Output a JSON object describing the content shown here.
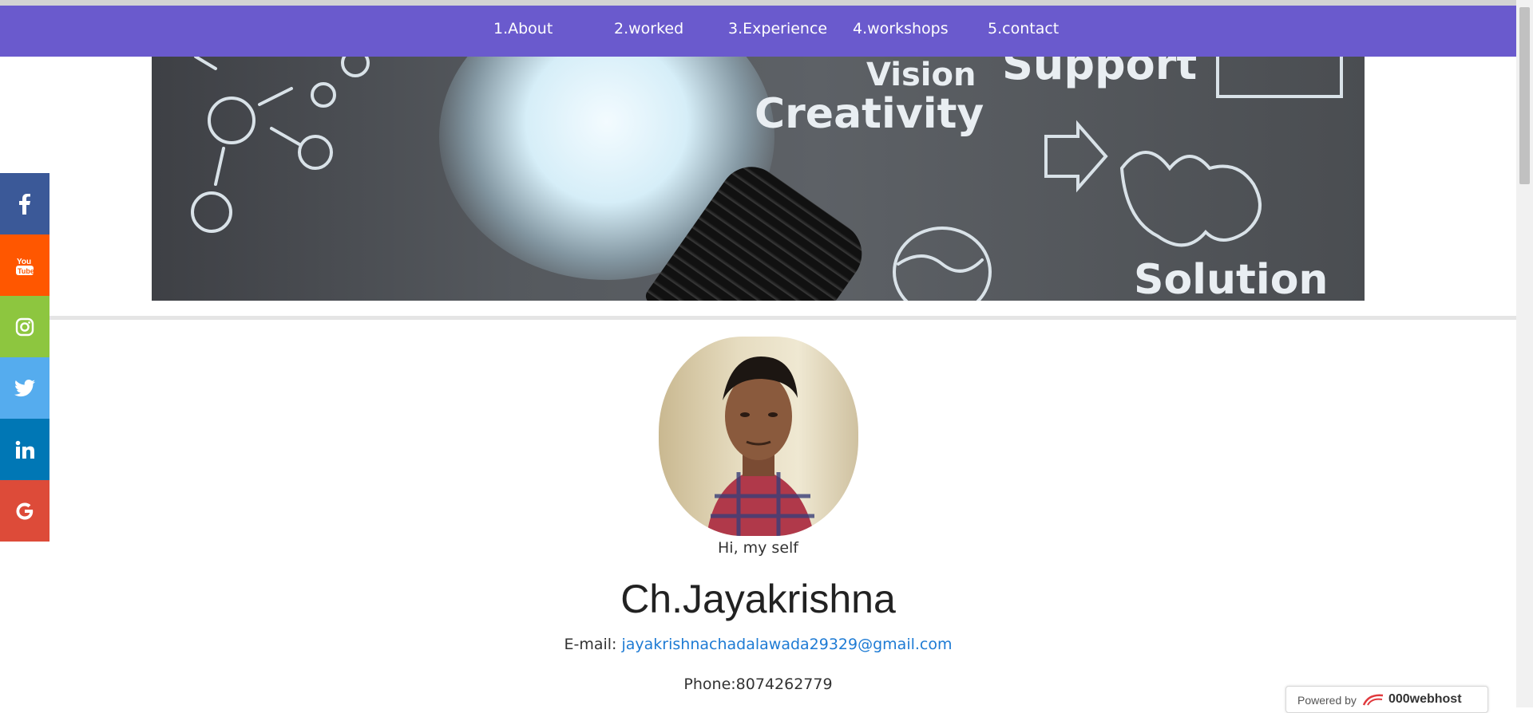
{
  "nav": {
    "items": [
      {
        "label": "1.About"
      },
      {
        "label": "2.worked"
      },
      {
        "label": "3.Experience"
      },
      {
        "label": "4.workshops"
      },
      {
        "label": "5.contact"
      }
    ],
    "background": "#6a5acd"
  },
  "banner": {
    "words": {
      "vision": "Vision",
      "creativity": "Creativity",
      "support": "Support",
      "solution": "Solution"
    }
  },
  "social": {
    "items": [
      {
        "name": "facebook",
        "icon": "facebook-icon",
        "color": "#3b5998"
      },
      {
        "name": "youtube",
        "icon": "youtube-icon",
        "color": "#ff5700"
      },
      {
        "name": "instagram",
        "icon": "instagram-icon",
        "color": "#8dc63f"
      },
      {
        "name": "twitter",
        "icon": "twitter-icon",
        "color": "#55acee"
      },
      {
        "name": "linkedin",
        "icon": "linkedin-icon",
        "color": "#0077b5"
      },
      {
        "name": "google",
        "icon": "google-icon",
        "color": "#dd4b39"
      }
    ]
  },
  "profile": {
    "greeting": "Hi, my self",
    "name": "Ch.Jayakrishna",
    "email_label": "E-mail: ",
    "email": "jayakrishnachadalawada29329@gmail.com",
    "phone": "Phone:8074262779"
  },
  "footer": {
    "powered_by": "Powered by",
    "brand": "000webhost"
  }
}
